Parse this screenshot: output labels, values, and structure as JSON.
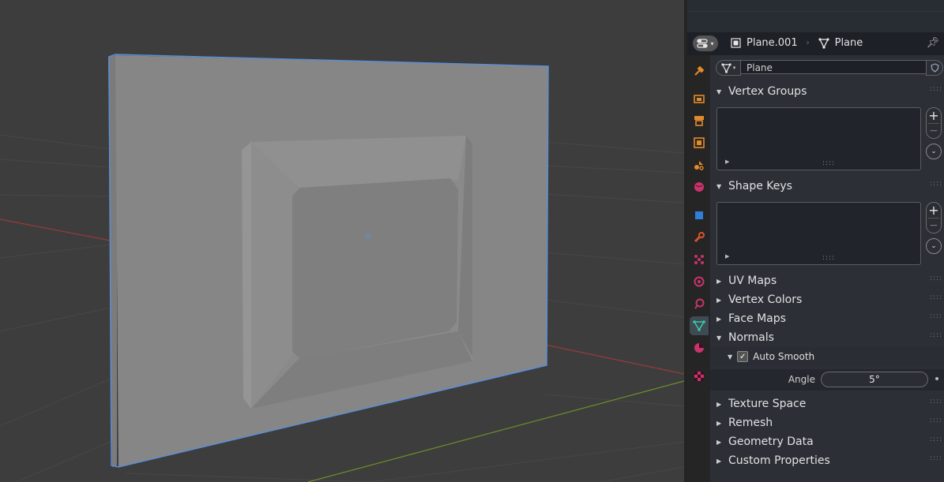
{
  "header": {
    "object_name": "Plane.001",
    "mesh_name": "Plane"
  },
  "datablock": {
    "name": "Plane"
  },
  "panels": {
    "vertex_groups": "Vertex Groups",
    "shape_keys": "Shape Keys",
    "uv_maps": "UV Maps",
    "vertex_colors": "Vertex Colors",
    "face_maps": "Face Maps",
    "normals": "Normals",
    "texture_space": "Texture Space",
    "remesh": "Remesh",
    "geometry_data": "Geometry Data",
    "custom_properties": "Custom Properties"
  },
  "normals": {
    "auto_smooth_label": "Auto Smooth",
    "auto_smooth_checked": true,
    "angle_label": "Angle",
    "angle_value": "5°"
  },
  "tabs": [
    {
      "id": "tool",
      "icon": "tool-icon",
      "color": "#e38a2b"
    },
    {
      "id": "render",
      "icon": "render-icon",
      "color": "#e38a2b"
    },
    {
      "id": "output",
      "icon": "output-icon",
      "color": "#e38a2b"
    },
    {
      "id": "view-layer",
      "icon": "view-layer-icon",
      "color": "#e38a2b"
    },
    {
      "id": "scene",
      "icon": "scene-icon",
      "color": "#e38a2b"
    },
    {
      "id": "world",
      "icon": "world-icon",
      "color": "#c7336b"
    },
    {
      "id": "object",
      "icon": "object-icon",
      "color": "#2f7fd8"
    },
    {
      "id": "modifiers",
      "icon": "wrench-icon",
      "color": "#d4552b"
    },
    {
      "id": "particles",
      "icon": "particles-icon",
      "color": "#c7336b"
    },
    {
      "id": "physics",
      "icon": "physics-icon",
      "color": "#c7336b"
    },
    {
      "id": "constraints",
      "icon": "constraints-icon",
      "color": "#c7336b"
    },
    {
      "id": "data",
      "icon": "mesh-data-icon",
      "color": "#37c8a8"
    },
    {
      "id": "material",
      "icon": "material-icon",
      "color": "#c7336b"
    },
    {
      "id": "texture",
      "icon": "texture-icon",
      "color": "#c7336b"
    }
  ],
  "colors": {
    "selection_outline": "#5b8fd6",
    "x_axis": "#9b3a3a",
    "y_axis": "#6c8f2a",
    "active_tab": "#3f4a52"
  }
}
